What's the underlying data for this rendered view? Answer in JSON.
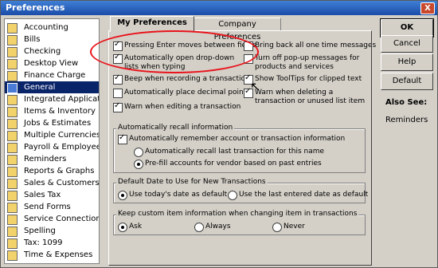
{
  "window": {
    "title": "Preferences",
    "close_label": "X"
  },
  "sidebar": {
    "items": [
      {
        "label": "Accounting"
      },
      {
        "label": "Bills"
      },
      {
        "label": "Checking"
      },
      {
        "label": "Desktop View"
      },
      {
        "label": "Finance Charge"
      },
      {
        "label": "General",
        "selected": true
      },
      {
        "label": "Integrated Applications"
      },
      {
        "label": "Items & Inventory"
      },
      {
        "label": "Jobs & Estimates"
      },
      {
        "label": "Multiple Currencies"
      },
      {
        "label": "Payroll & Employees"
      },
      {
        "label": "Reminders"
      },
      {
        "label": "Reports & Graphs"
      },
      {
        "label": "Sales & Customers"
      },
      {
        "label": "Sales Tax"
      },
      {
        "label": "Send Forms"
      },
      {
        "label": "Service Connection"
      },
      {
        "label": "Spelling"
      },
      {
        "label": "Tax: 1099"
      },
      {
        "label": "Time & Expenses"
      }
    ]
  },
  "tabs": {
    "my_preferences": "My Preferences",
    "company_preferences": "Company Preferences"
  },
  "options": {
    "enter_moves": "Pressing Enter moves between fields",
    "auto_dropdown": "Automatically open drop-down lists when typing",
    "beep": "Beep when recording a transaction",
    "decimal": "Automatically place decimal point",
    "warn_editing": "Warn when editing a transaction",
    "bring_back": "Bring back all one time messages",
    "popup": "Turn off pop-up messages for products and services",
    "tooltips": "Show ToolTips for clipped text",
    "warn_delete": "Warn when deleting a transaction or unused list item"
  },
  "recall": {
    "title": "Automatically recall information",
    "remember": "Automatically remember account or transaction information",
    "last_trans": "Automatically recall last transaction for this name",
    "prefill": "Pre-fill accounts for vendor based on past entries"
  },
  "date": {
    "title": "Default Date to Use for New Transactions",
    "today": "Use today's date as default",
    "last": "Use the last entered date as default"
  },
  "custom": {
    "title": "Keep custom item information when changing item in transactions",
    "ask": "Ask",
    "always": "Always",
    "never": "Never"
  },
  "buttons": {
    "ok": "OK",
    "cancel": "Cancel",
    "help": "Help",
    "default": "Default"
  },
  "also_see": {
    "title": "Also See:",
    "link": "Reminders"
  }
}
